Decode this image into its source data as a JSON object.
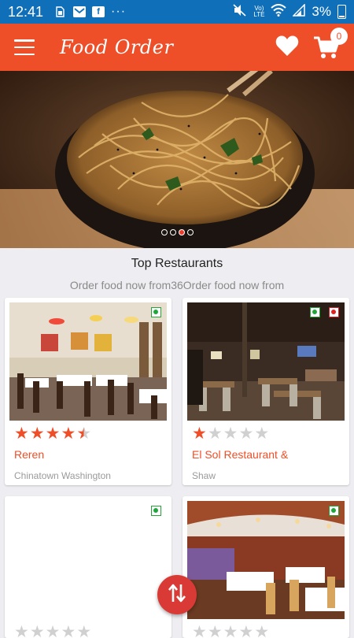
{
  "status_bar": {
    "time": "12:41",
    "left_icons": [
      "sim-icon",
      "mail-icon",
      "facebook-icon",
      "more-icon"
    ],
    "more_text": "···",
    "right_icons": [
      "mute-icon",
      "volte-icon",
      "wifi-icon",
      "signal-icon",
      "battery-icon"
    ],
    "volte": "Vo)\nLTE",
    "battery_percent": "3%"
  },
  "app_bar": {
    "title": "Food Order",
    "cart_count": "0",
    "color": "#ee4f28"
  },
  "banner": {
    "slide_count": 4,
    "active_slide": 3
  },
  "section": {
    "title": "Top Restaurants",
    "subtitle": "Order food now from36Order food now from"
  },
  "restaurants": [
    {
      "name": "Reren",
      "location": "Chinatown Washington",
      "rating": 4.5,
      "badges": [
        "veg"
      ]
    },
    {
      "name": "El Sol Restaurant &",
      "location": "Shaw",
      "rating": 1,
      "badges": [
        "veg",
        "non-veg"
      ]
    },
    {
      "name": "",
      "location": "",
      "rating": 0,
      "badges": [
        "veg"
      ]
    },
    {
      "name": "",
      "location": "",
      "rating": 0,
      "badges": [
        "veg"
      ]
    }
  ],
  "colors": {
    "status_bar": "#0f6fb8",
    "accent": "#ee4f28",
    "background": "#eeeef2",
    "fab": "#d93a36"
  }
}
